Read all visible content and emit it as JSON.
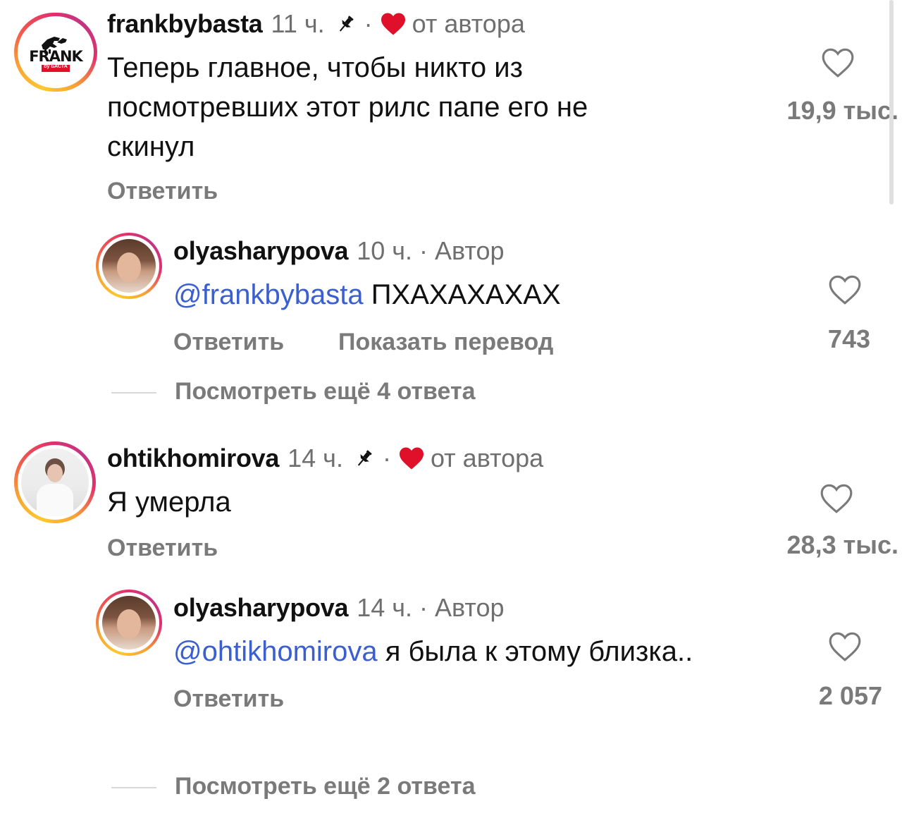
{
  "comments": [
    {
      "username": "frankbybasta",
      "time": "11 ч.",
      "author_label": "от автора",
      "text_lines": [
        "Теперь главное, чтобы никто из",
        "посмотревших этот рилс папе его не",
        "скинул"
      ],
      "reply_label": "Ответить",
      "like_count": "19,9 тыс.",
      "avatar_logo": "FRANK",
      "avatar_logo_sub": "by БАСТА",
      "replies": [
        {
          "username": "olyasharypova",
          "time": "10 ч.",
          "author_label": "Автор",
          "mention": "@frankbybasta",
          "text": "ПХАХАХАХАХ",
          "reply_label": "Ответить",
          "translate_label": "Показать перевод",
          "like_count": "743"
        }
      ],
      "more_replies_label": "Посмотреть ещё 4 ответа"
    },
    {
      "username": "ohtikhomirova",
      "time": "14 ч.",
      "author_label": "от автора",
      "text": "Я умерла",
      "reply_label": "Ответить",
      "like_count": "28,3 тыс.",
      "replies": [
        {
          "username": "olyasharypova",
          "time": "14 ч.",
          "author_label": "Автор",
          "mention": "@ohtikhomirova",
          "text": "я была к этому близка..",
          "reply_label": "Ответить",
          "like_count": "2 057"
        }
      ],
      "more_replies_label": "Посмотреть ещё 2 ответа"
    }
  ],
  "separator": "·",
  "icons": {
    "pin": "pin-icon",
    "liked_by_author": "red-heart-icon",
    "like": "heart-outline-icon"
  },
  "colors": {
    "mention": "#3a5fd0",
    "heart_red": "#e0102a",
    "meta_gray": "#6f6f6f"
  }
}
